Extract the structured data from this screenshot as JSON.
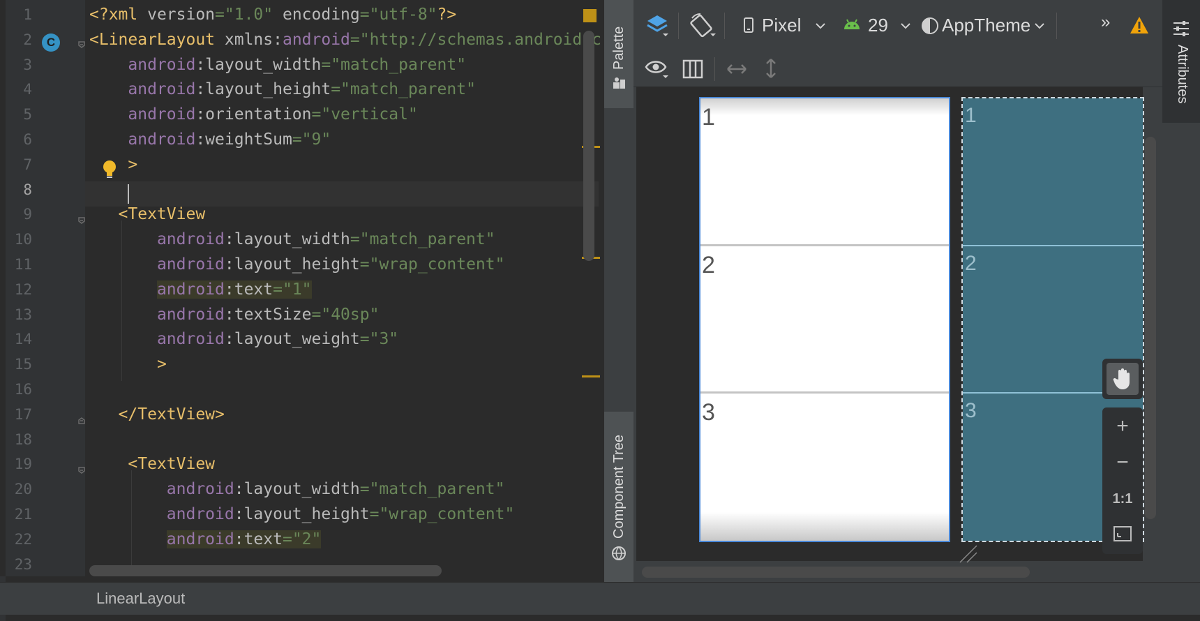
{
  "editor": {
    "line_numbers": [
      "1",
      "2",
      "3",
      "4",
      "5",
      "6",
      "7",
      "8",
      "9",
      "10",
      "11",
      "12",
      "13",
      "14",
      "15",
      "16",
      "17",
      "18",
      "19",
      "20",
      "21",
      "22",
      "23"
    ],
    "current_line": "8",
    "lines": [
      [
        {
          "c": "t-pi",
          "t": "<?xml "
        },
        {
          "c": "t-plain",
          "t": "version"
        },
        {
          "c": "t-str",
          "t": "=\"1.0\""
        },
        {
          "c": "t-plain",
          "t": " encoding"
        },
        {
          "c": "t-str",
          "t": "=\"utf-8\""
        },
        {
          "c": "t-pi",
          "t": "?>"
        }
      ],
      [
        {
          "c": "t-tag",
          "t": "<LinearLayout "
        },
        {
          "c": "t-plain",
          "t": "xmlns:"
        },
        {
          "c": "t-attr",
          "t": "android"
        },
        {
          "c": "t-str",
          "t": "=\"http://schemas.android.c"
        }
      ],
      [
        {
          "c": "t-plain",
          "t": "    "
        },
        {
          "c": "t-attr",
          "t": "android"
        },
        {
          "c": "t-plain",
          "t": ":layout_width"
        },
        {
          "c": "t-str",
          "t": "=\"match_parent\""
        }
      ],
      [
        {
          "c": "t-plain",
          "t": "    "
        },
        {
          "c": "t-attr",
          "t": "android"
        },
        {
          "c": "t-plain",
          "t": ":layout_height"
        },
        {
          "c": "t-str",
          "t": "=\"match_parent\""
        }
      ],
      [
        {
          "c": "t-plain",
          "t": "    "
        },
        {
          "c": "t-attr",
          "t": "android"
        },
        {
          "c": "t-plain",
          "t": ":orientation"
        },
        {
          "c": "t-str",
          "t": "=\"vertical\""
        }
      ],
      [
        {
          "c": "t-plain",
          "t": "    "
        },
        {
          "c": "t-attr",
          "t": "android"
        },
        {
          "c": "t-plain",
          "t": ":weightSum"
        },
        {
          "c": "t-str",
          "t": "=\"9\""
        }
      ],
      [
        {
          "c": "t-plain",
          "t": "    "
        },
        {
          "c": "t-tag",
          "t": ">"
        }
      ],
      [
        {
          "c": "t-plain",
          "t": "    "
        }
      ],
      [
        {
          "c": "t-plain",
          "t": "   "
        },
        {
          "c": "t-tag",
          "t": "<TextView"
        }
      ],
      [
        {
          "c": "t-plain",
          "t": "       "
        },
        {
          "c": "t-attr",
          "t": "android"
        },
        {
          "c": "t-plain",
          "t": ":layout_width"
        },
        {
          "c": "t-str",
          "t": "=\"match_parent\""
        }
      ],
      [
        {
          "c": "t-plain",
          "t": "       "
        },
        {
          "c": "t-attr",
          "t": "android"
        },
        {
          "c": "t-plain",
          "t": ":layout_height"
        },
        {
          "c": "t-str",
          "t": "=\"wrap_content\""
        }
      ],
      [
        {
          "c": "t-plain",
          "t": "       "
        },
        {
          "c": "t-attr hl",
          "t": "android"
        },
        {
          "c": "t-plain hl",
          "t": ":text"
        },
        {
          "c": "t-str hl",
          "t": "=\"1\""
        }
      ],
      [
        {
          "c": "t-plain",
          "t": "       "
        },
        {
          "c": "t-attr",
          "t": "android"
        },
        {
          "c": "t-plain",
          "t": ":textSize"
        },
        {
          "c": "t-str",
          "t": "=\"40sp\""
        }
      ],
      [
        {
          "c": "t-plain",
          "t": "       "
        },
        {
          "c": "t-attr",
          "t": "android"
        },
        {
          "c": "t-plain",
          "t": ":layout_weight"
        },
        {
          "c": "t-str",
          "t": "=\"3\""
        }
      ],
      [
        {
          "c": "t-plain",
          "t": "       "
        },
        {
          "c": "t-tag",
          "t": ">"
        }
      ],
      [
        {
          "c": "t-plain",
          "t": ""
        }
      ],
      [
        {
          "c": "t-plain",
          "t": "   "
        },
        {
          "c": "t-tag",
          "t": "</TextView>"
        }
      ],
      [
        {
          "c": "t-plain",
          "t": ""
        }
      ],
      [
        {
          "c": "t-plain",
          "t": "    "
        },
        {
          "c": "t-tag",
          "t": "<TextView"
        }
      ],
      [
        {
          "c": "t-plain",
          "t": "        "
        },
        {
          "c": "t-attr",
          "t": "android"
        },
        {
          "c": "t-plain",
          "t": ":layout_width"
        },
        {
          "c": "t-str",
          "t": "=\"match_parent\""
        }
      ],
      [
        {
          "c": "t-plain",
          "t": "        "
        },
        {
          "c": "t-attr",
          "t": "android"
        },
        {
          "c": "t-plain",
          "t": ":layout_height"
        },
        {
          "c": "t-str",
          "t": "=\"wrap_content\""
        }
      ],
      [
        {
          "c": "t-plain",
          "t": "        "
        },
        {
          "c": "t-attr hl",
          "t": "android"
        },
        {
          "c": "t-plain hl",
          "t": ":text"
        },
        {
          "c": "t-str hl",
          "t": "=\"2\""
        }
      ],
      [
        {
          "c": "t-plain",
          "t": ""
        }
      ]
    ]
  },
  "status_bar": {
    "breadcrumb": "LinearLayout"
  },
  "side_tabs": {
    "palette": "Palette",
    "component_tree": "Component Tree",
    "attributes": "Attributes"
  },
  "toolbar": {
    "device": "Pixel",
    "api_level": "29",
    "theme": "AppTheme",
    "overflow": "»"
  },
  "preview": {
    "cells": [
      "1",
      "2",
      "3"
    ],
    "blueprint_cells": [
      "1",
      "2",
      "3"
    ]
  },
  "zoom": {
    "zoom_in": "+",
    "zoom_out": "−",
    "actual_size": "1:1"
  },
  "colors": {
    "editor_bg": "#2b2b2b",
    "tag": "#e8bf6a",
    "attr": "#9876aa",
    "string": "#6a8759",
    "blueprint": "#3e6f80",
    "selection": "#4a88d8",
    "warning": "#f0a30a"
  }
}
